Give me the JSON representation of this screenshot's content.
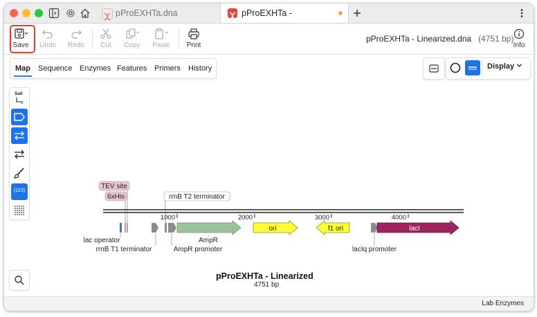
{
  "tabs": [
    {
      "label": "pProEXHTa.dna"
    },
    {
      "label": "pProEXHTa - Linearized.dna"
    }
  ],
  "toolbar": {
    "save": "Save",
    "undo": "Undo",
    "redo": "Redo",
    "cut": "Cut",
    "copy": "Copy",
    "paste": "Paste",
    "print": "Print",
    "info": "Info"
  },
  "document": {
    "title": "pProEXHTa - Linearized.dna",
    "size": "(4751 bp)"
  },
  "view_tabs": [
    "Map",
    "Sequence",
    "Enzymes",
    "Features",
    "Primers",
    "History"
  ],
  "selected_view_tab": "Map",
  "display_label": "Display",
  "palette": {
    "enzyme_label": "SalI",
    "numbers_label": "(123)"
  },
  "map": {
    "ruler_ticks": [
      "1000",
      "2000",
      "3000",
      "4000"
    ],
    "features_above": {
      "tev": "TEV site",
      "his": "6xHis",
      "rrnb_t2": "rrnB T2 terminator"
    },
    "arrow_labels": {
      "ori": "ori",
      "f1_ori": "f1 ori",
      "laci": "lacI"
    },
    "below_labels": {
      "lac_operator": "lac operator",
      "rrnb_t1": "rrnB T1 terminator",
      "ampr": "AmpR",
      "ampr_promoter": "AmpR promoter",
      "laciq_promoter": "lacIq promoter"
    },
    "colors": {
      "ampr": "#9cc29a",
      "ori": "#ffff33",
      "f1_ori": "#ffff33",
      "laci": "#9e2461",
      "tev": "#e7c6d3",
      "promoter": "#8c8c8c"
    },
    "name": "pProEXHTa - Linearized",
    "length": "4751 bp"
  },
  "status": "Lab Enzymes"
}
